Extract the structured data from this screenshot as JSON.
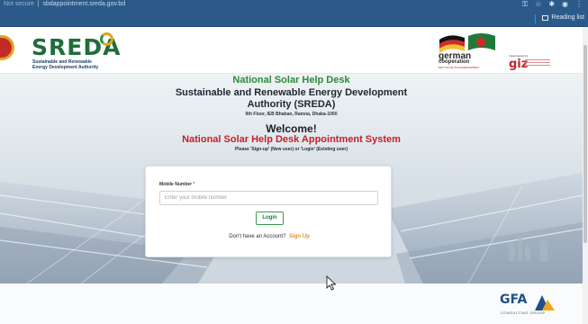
{
  "browser": {
    "security_label": "Not secure",
    "url": "sbdappointment.sreda.gov.bd",
    "reading_list_label": "Reading list",
    "icons": [
      "key-icon",
      "star-icon",
      "extensions-icon",
      "profile-icon",
      "menu-icon"
    ]
  },
  "header": {
    "brand_name": "SREDA",
    "brand_sub_line1": "Sustainable and Renewable",
    "brand_sub_line2": "Energy Development Authority",
    "partner_name_line1": "german",
    "partner_name_line2": "cooperation",
    "partner_tagline": "DEUTSCHE ZUSAMMENARBEIT",
    "partner2_small": "Implemented by",
    "partner2_name": "giz"
  },
  "hero": {
    "title_line1": "National Solar Help Desk",
    "title_line2": "Sustainable and Renewable Energy Development",
    "title_line3": "Authority (SREDA)",
    "address": "9th Floor, IEB Bhaban, Ramna, Dhaka-1000",
    "welcome": "Welcome!",
    "system_title": "National Solar Help Desk Appointment System",
    "hint": "Please 'Sign-up' (New user) or 'Login' (Existing user)"
  },
  "login_form": {
    "mobile_label": "Mobile Number",
    "required_mark": "*",
    "mobile_placeholder": "Enter your mobile number",
    "mobile_value": "",
    "login_button": "Login",
    "no_account_text": "Don't have an Account?",
    "signup_link": "Sign Up"
  },
  "footer": {
    "logo_name": "GFA",
    "logo_sub": "CONSULTING GROUP"
  },
  "colors": {
    "chrome": "#2b5a8a",
    "brand_green": "#2d8a3a",
    "alert_red": "#c72027",
    "signup_orange": "#d9952a"
  }
}
